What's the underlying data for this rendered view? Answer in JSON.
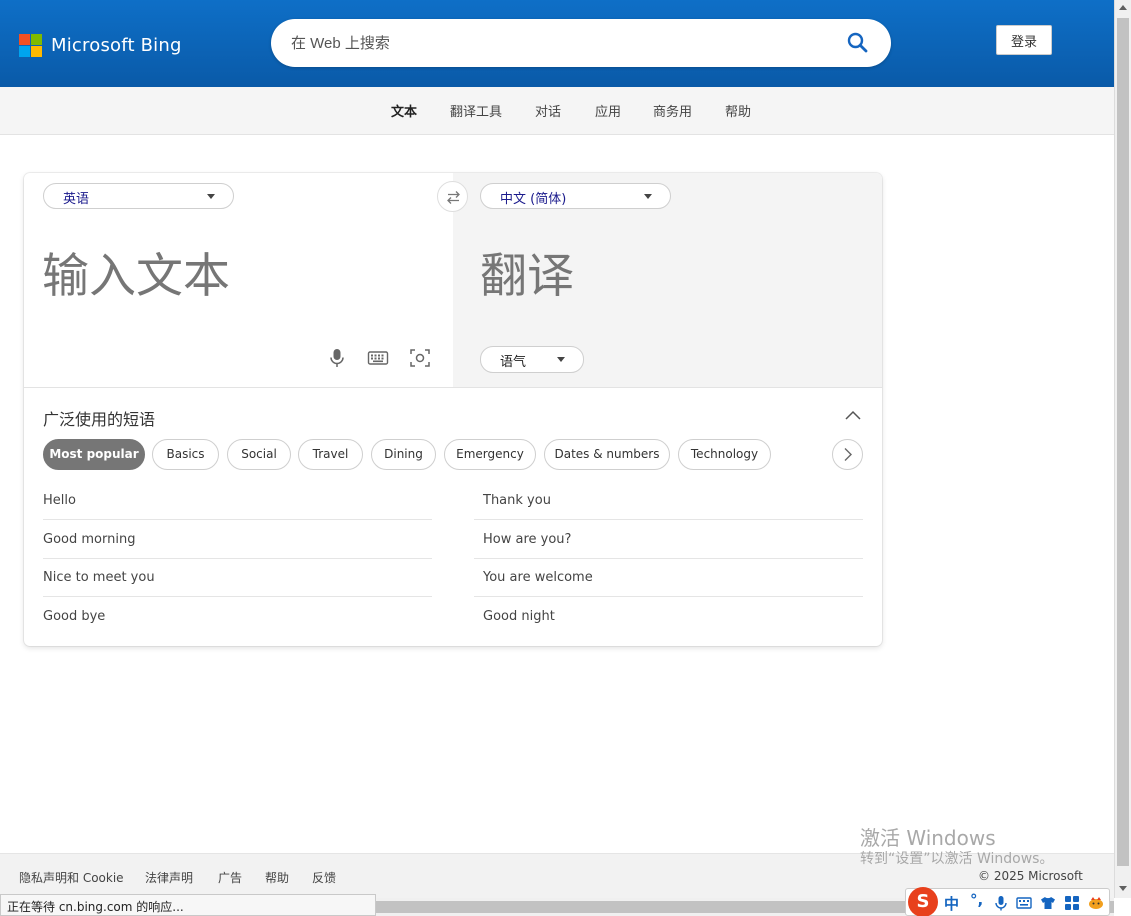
{
  "header": {
    "brand": "Microsoft Bing",
    "search_placeholder": "在 Web 上搜索",
    "login_label": "登录"
  },
  "colors": {
    "header_blue": "#0a5aa8",
    "ms_red": "#f25022",
    "ms_green": "#7fba00",
    "ms_blue": "#00a4ef",
    "ms_yellow": "#ffb900"
  },
  "subnav": {
    "items": [
      "文本",
      "翻译工具",
      "对话",
      "应用",
      "商务用",
      "帮助"
    ],
    "active_index": 0
  },
  "translator": {
    "source_lang": "英语",
    "target_lang": "中文 (简体)",
    "input_placeholder": "输入文本",
    "output_placeholder": "翻译",
    "tone_label": "语气",
    "tools": [
      "microphone-icon",
      "keyboard-icon",
      "camera-scan-icon"
    ]
  },
  "phrases": {
    "title": "广泛使用的短语",
    "chips": [
      "Most popular",
      "Basics",
      "Social",
      "Travel",
      "Dining",
      "Emergency",
      "Dates & numbers",
      "Technology"
    ],
    "active_chip": 0,
    "left": [
      "Hello",
      "Good morning",
      "Nice to meet you",
      "Good bye"
    ],
    "right": [
      "Thank you",
      "How are you?",
      "You are welcome",
      "Good night"
    ]
  },
  "watermark": {
    "line1": "激活 Windows",
    "line2": "转到“设置”以激活 Windows。"
  },
  "footer": {
    "links": [
      "隐私声明和 Cookie",
      "法律声明",
      "广告",
      "帮助",
      "反馈"
    ],
    "copyright": "© 2025 Microsoft"
  },
  "statusbar": {
    "text": "正在等待 cn.bing.com 的响应..."
  },
  "ime": {
    "logo": "S",
    "mode": "中",
    "punct": "°,"
  }
}
